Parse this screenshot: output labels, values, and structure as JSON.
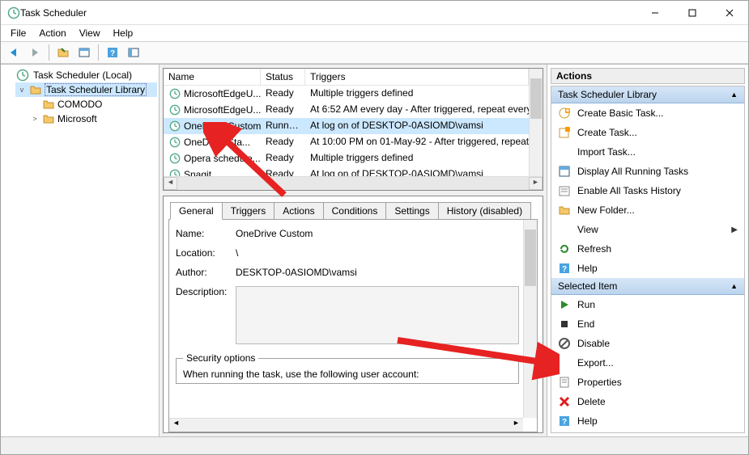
{
  "window": {
    "title": "Task Scheduler"
  },
  "menu": [
    "File",
    "Action",
    "View",
    "Help"
  ],
  "tree": {
    "root": "Task Scheduler (Local)",
    "library": "Task Scheduler Library",
    "children": [
      "COMODO",
      "Microsoft"
    ]
  },
  "columns": {
    "name": "Name",
    "status": "Status",
    "triggers": "Triggers"
  },
  "tasks": [
    {
      "name": "MicrosoftEdgeU...",
      "status": "Ready",
      "triggers": "Multiple triggers defined"
    },
    {
      "name": "MicrosoftEdgeU...",
      "status": "Ready",
      "triggers": "At 6:52 AM every day - After triggered, repeat every"
    },
    {
      "name": "OneDrive Custom",
      "status": "Running",
      "triggers": "At log on of DESKTOP-0ASIOMD\\vamsi",
      "selected": true
    },
    {
      "name": "OneDrive Sta...",
      "status": "Ready",
      "triggers": "At 10:00 PM on 01-May-92 - After triggered, repeat"
    },
    {
      "name": "Opera schedule...",
      "status": "Ready",
      "triggers": "Multiple triggers defined"
    },
    {
      "name": "Snagit",
      "status": "Ready",
      "triggers": "At log on of DESKTOP-0ASIOMD\\vamsi"
    }
  ],
  "tabs": [
    "General",
    "Triggers",
    "Actions",
    "Conditions",
    "Settings",
    "History (disabled)"
  ],
  "general": {
    "labels": {
      "name": "Name:",
      "location": "Location:",
      "author": "Author:",
      "description": "Description:"
    },
    "name": "OneDrive Custom",
    "location": "\\",
    "author": "DESKTOP-0ASIOMD\\vamsi",
    "security_legend": "Security options",
    "security_text": "When running the task, use the following user account:"
  },
  "actions": {
    "header": "Actions",
    "section1_title": "Task Scheduler Library",
    "items1": [
      {
        "label": "Create Basic Task...",
        "icon": "create-basic"
      },
      {
        "label": "Create Task...",
        "icon": "create"
      },
      {
        "label": "Import Task...",
        "icon": "import"
      },
      {
        "label": "Display All Running Tasks",
        "icon": "running"
      },
      {
        "label": "Enable All Tasks History",
        "icon": "history"
      },
      {
        "label": "New Folder...",
        "icon": "folder"
      },
      {
        "label": "View",
        "icon": "view",
        "submenu": true
      },
      {
        "label": "Refresh",
        "icon": "refresh"
      },
      {
        "label": "Help",
        "icon": "help"
      }
    ],
    "section2_title": "Selected Item",
    "items2": [
      {
        "label": "Run",
        "icon": "run"
      },
      {
        "label": "End",
        "icon": "end"
      },
      {
        "label": "Disable",
        "icon": "disable"
      },
      {
        "label": "Export...",
        "icon": "export"
      },
      {
        "label": "Properties",
        "icon": "properties"
      },
      {
        "label": "Delete",
        "icon": "delete"
      },
      {
        "label": "Help",
        "icon": "help"
      }
    ]
  }
}
